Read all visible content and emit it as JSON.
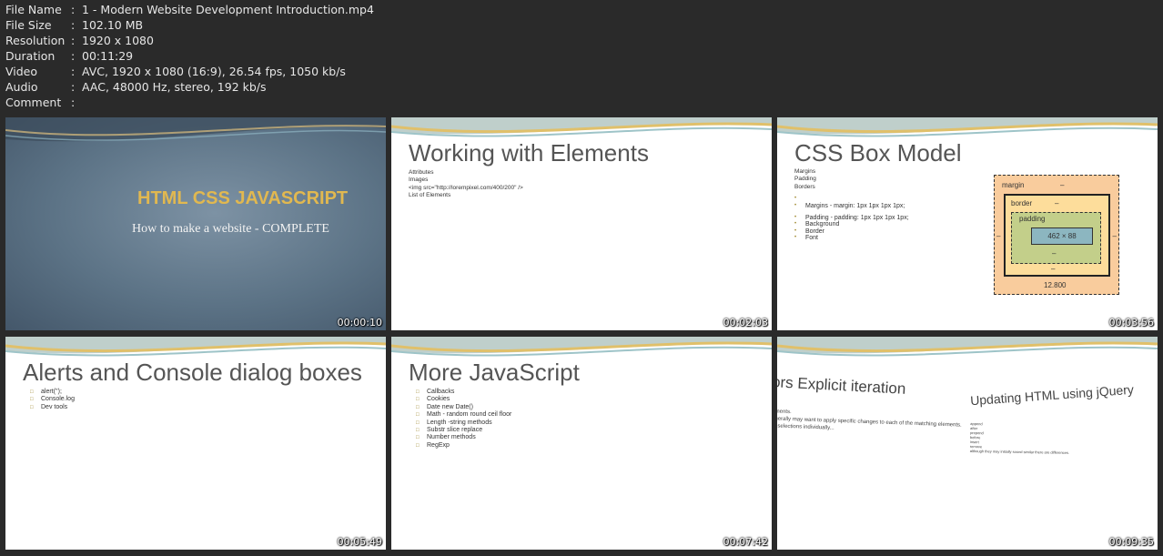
{
  "info": [
    {
      "key": "File Name",
      "value": "1 - Modern Website Development Introduction.mp4"
    },
    {
      "key": "File Size",
      "value": "102.10 MB"
    },
    {
      "key": "Resolution",
      "value": "1920 x 1080"
    },
    {
      "key": "Duration",
      "value": "00:11:29"
    },
    {
      "key": "Video",
      "value": "AVC, 1920 x 1080 (16:9), 26.54 fps, 1050 kb/s"
    },
    {
      "key": "Audio",
      "value": "AAC, 48000 Hz, stereo, 192 kb/s"
    },
    {
      "key": "Comment",
      "value": ""
    }
  ],
  "separator": ":",
  "thumbs": [
    {
      "timestamp": "00:00:10",
      "title": "HTML CSS JAVASCRIPT",
      "subtitle": "How to make a website - COMPLETE"
    },
    {
      "timestamp": "00:02:03",
      "title": "Working with Elements",
      "lines": [
        "Attributes",
        "Images",
        "<img src=\"http://lorempixel.com/400/200\" />",
        "List of Elements"
      ]
    },
    {
      "timestamp": "00:03:56",
      "title": "CSS Box Model",
      "lines_top": [
        "Margins",
        "Padding",
        "Borders"
      ],
      "bullets": [
        "",
        "Margins - margin: 1px 1px 1px 1px;",
        "Padding - padding: 1px 1px 1px 1px;",
        "Background",
        "Border",
        "Font"
      ],
      "box": {
        "margin": "margin",
        "border": "border",
        "padding": "padding",
        "content": "462 × 88",
        "dash": "–",
        "bottom_value": "12.800"
      }
    },
    {
      "timestamp": "00:05:49",
      "title": "Alerts and Console dialog boxes",
      "bullets": [
        "alert('');",
        "Console.log",
        "Dev tools"
      ]
    },
    {
      "timestamp": "00:07:42",
      "title": "More JavaScript",
      "bullets": [
        "Callbacks",
        "Cookies",
        "Date new Date()",
        "Math - random round ceil floor",
        "Length -string methods",
        "Substr slice replace",
        "Number methods",
        "RegExp"
      ]
    },
    {
      "timestamp": "00:09:35",
      "left_title": "ors Explicit iteration",
      "right_title": "Updating HTML using jQuery",
      "left_lines": [
        "ements.",
        "enerally may want to apply specific changes to each of the matching elements.",
        "ut selections individually..."
      ],
      "right_lines": [
        "append",
        "after",
        "prepend",
        "before",
        "insert",
        "remove",
        "although they may initially sound similar there are differences."
      ]
    }
  ],
  "colors": {
    "background": "#2a2a2a",
    "text": "#e6e6e6",
    "dark_slide_title": "#e1b850"
  }
}
